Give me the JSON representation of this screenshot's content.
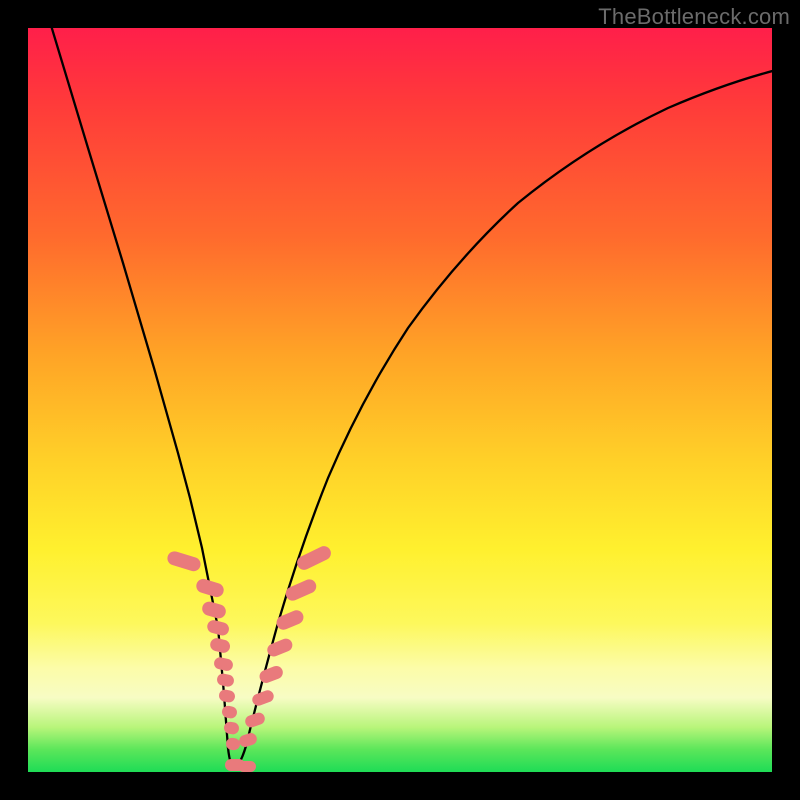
{
  "watermark": "TheBottleneck.com",
  "colors": {
    "curve": "#000000",
    "marker": "#e97a7c",
    "gradient_top": "#ff1f4a",
    "gradient_mid": "#fff02e",
    "gradient_bottom": "#1edc56",
    "frame": "#000000"
  },
  "chart_data": {
    "type": "line",
    "title": "",
    "xlabel": "",
    "ylabel": "",
    "xlim": [
      0,
      100
    ],
    "ylim": [
      0,
      100
    ],
    "x": [
      0,
      1,
      2,
      3,
      4,
      5,
      6,
      7,
      8,
      9,
      10,
      11,
      12,
      13,
      14,
      15,
      16,
      17,
      18,
      19,
      20,
      21,
      22,
      23,
      24,
      25,
      26,
      27,
      28,
      29,
      30,
      31,
      32,
      33,
      34,
      35,
      36,
      37,
      38,
      39,
      40,
      41,
      42,
      43,
      44,
      45,
      46,
      47,
      48,
      49,
      50,
      52,
      54,
      56,
      58,
      60,
      62,
      64,
      66,
      68,
      70,
      72,
      74,
      76,
      78,
      80,
      82,
      84,
      86,
      88,
      90,
      92,
      94,
      96,
      98,
      100
    ],
    "y": [
      100,
      96.0,
      92.0,
      88.0,
      84.0,
      80.0,
      76.0,
      72.0,
      68.0,
      64.0,
      60.0,
      56.0,
      52.0,
      48.0,
      44.0,
      40.0,
      36.0,
      32.0,
      28.0,
      24.0,
      20.0,
      16.0,
      12.0,
      8.0,
      4.0,
      0.0,
      2.9,
      5.8,
      8.6,
      11.3,
      14.0,
      16.6,
      19.2,
      21.7,
      24.1,
      26.5,
      28.8,
      31.1,
      33.3,
      35.4,
      37.5,
      39.5,
      41.5,
      43.4,
      45.3,
      47.1,
      48.8,
      50.5,
      52.2,
      53.8,
      55.3,
      58.3,
      61.1,
      63.8,
      66.3,
      68.6,
      70.8,
      72.9,
      74.8,
      76.7,
      78.4,
      80.0,
      81.5,
      82.9,
      84.3,
      85.5,
      86.7,
      87.8,
      88.8,
      89.8,
      90.7,
      91.5,
      92.3,
      93.0,
      93.7,
      94.3
    ],
    "markers": {
      "x": [
        17,
        17.5,
        18,
        18.7,
        19.3,
        20,
        20.6,
        21.2,
        21.8,
        22.3,
        22.8,
        23.3,
        23.8,
        24.2,
        24.6,
        25,
        25.0,
        25.5,
        26.1,
        26.9,
        27.8,
        28.8,
        29.8,
        30.8,
        31.8,
        32.8,
        33.6,
        34.4,
        35.0
      ],
      "y": [
        28,
        26,
        24,
        21,
        19,
        16,
        14,
        12,
        10,
        8.5,
        7,
        5.5,
        4,
        3,
        2,
        1,
        0.3,
        0.8,
        2.5,
        4.5,
        7,
        10,
        12.5,
        15,
        17.5,
        20,
        22,
        24,
        26
      ]
    }
  }
}
